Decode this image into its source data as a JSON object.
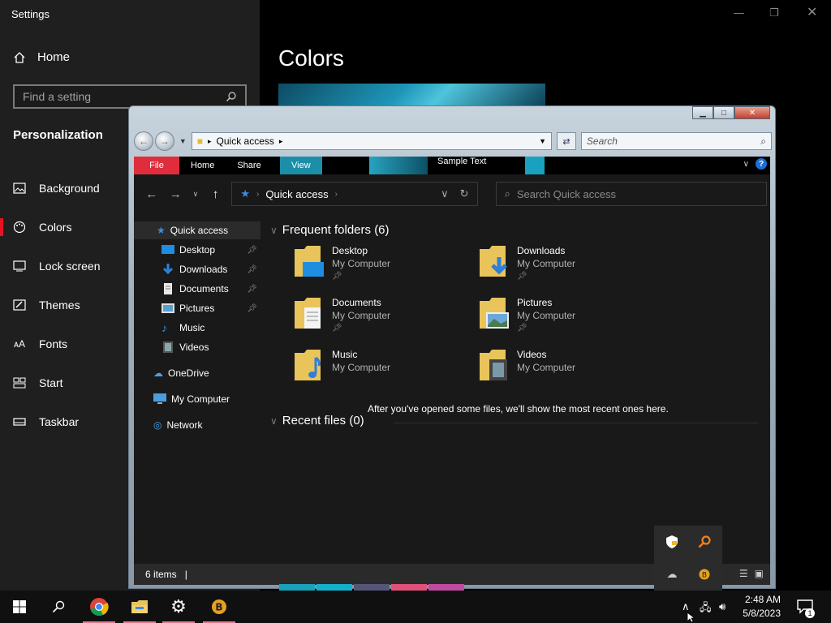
{
  "settings": {
    "title": "Settings",
    "home_label": "Home",
    "search_placeholder": "Find a setting",
    "section_label": "Personalization",
    "nav_items": [
      {
        "label": "Background",
        "icon": "image-icon"
      },
      {
        "label": "Colors",
        "icon": "palette-icon"
      },
      {
        "label": "Lock screen",
        "icon": "lock-screen-icon"
      },
      {
        "label": "Themes",
        "icon": "themes-icon"
      },
      {
        "label": "Fonts",
        "icon": "fonts-icon"
      },
      {
        "label": "Start",
        "icon": "start-icon"
      },
      {
        "label": "Taskbar",
        "icon": "taskbar-icon"
      }
    ],
    "page_title": "Colors",
    "accent_color": "#e81123"
  },
  "explorer": {
    "classic_path": "Quick access",
    "classic_search": "Search",
    "ribbon": {
      "file": "File",
      "home": "Home",
      "share": "Share",
      "view": "View",
      "sample_text": "Sample Text"
    },
    "address": "Quick access",
    "search_placeholder": "Search Quick access",
    "sidebar": {
      "quick_access": "Quick access",
      "pinned": [
        "Desktop",
        "Downloads",
        "Documents",
        "Pictures"
      ],
      "other": [
        "Music",
        "Videos"
      ],
      "onedrive": "OneDrive",
      "my_computer": "My Computer",
      "network": "Network"
    },
    "frequent_title": "Frequent folders (6)",
    "folders": [
      {
        "name": "Desktop",
        "location": "My Computer",
        "pinned": true
      },
      {
        "name": "Downloads",
        "location": "My Computer",
        "pinned": true
      },
      {
        "name": "Documents",
        "location": "My Computer",
        "pinned": true
      },
      {
        "name": "Pictures",
        "location": "My Computer",
        "pinned": true
      },
      {
        "name": "Music",
        "location": "My Computer",
        "pinned": false
      },
      {
        "name": "Videos",
        "location": "My Computer",
        "pinned": false
      }
    ],
    "recent_title": "Recent files (0)",
    "recent_empty": "After you've opened some files, we'll show the most recent ones here.",
    "status": "6 items"
  },
  "taskbar": {
    "time": "2:48 AM",
    "date": "5/8/2023",
    "notifications": "1"
  }
}
